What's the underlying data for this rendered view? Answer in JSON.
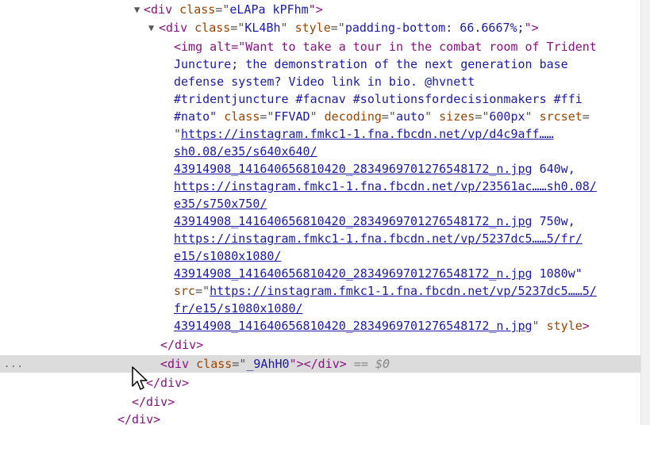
{
  "dom": {
    "line1": {
      "open": "<div",
      "attr": "class",
      "q": "=\"",
      "val": "eLAPa kPFhm",
      "close": "\">"
    },
    "line2": {
      "open": "<div",
      "class_attr": "class",
      "class_val": "KL4Bh",
      "style_attr": "style",
      "style_val": "padding-bottom: 66.6667%;",
      "close": "\">"
    },
    "img": {
      "line1": "<img alt=\"Want to take a tour in the combat room of Trident",
      "line2": "Juncture; the demonstration of the next generation base",
      "line3": "defense system? Video link in bio. @hvnett",
      "line4": "#tridentjuncture #facnav #solutionsfordecisionmakers #ffi",
      "line5_val": "#nato\"",
      "line5_class_attr": "class",
      "line5_class_val": "FFVAD",
      "line5_dec_attr": "decoding",
      "line5_dec_val": "auto",
      "line5_sizes_attr": "sizes",
      "line5_sizes_val": "600px",
      "line5_srcset_attr": "srcset",
      "srcset_link1a": "https://instagram.fmkc1-1.fna.fbcdn.net/vp/d4c9aff……",
      "srcset_link1b": "sh0.08/e35/s640x640/",
      "srcset_link1c": "43914908_141640656810420_2834969701276548172_n.jpg",
      "srcset_w1": "640w,",
      "srcset_link2a": "https://instagram.fmkc1-1.fna.fbcdn.net/vp/23561ac……sh0.08/",
      "srcset_link2b": "e35/s750x750/",
      "srcset_link2c": "43914908_141640656810420_2834969701276548172_n.jpg",
      "srcset_w2": "750w,",
      "srcset_link3a": "https://instagram.fmkc1-1.fna.fbcdn.net/vp/5237dc5……5/fr/",
      "srcset_link3b": "e15/s1080x1080/",
      "srcset_link3c": "43914908_141640656810420_2834969701276548172_n.jpg",
      "srcset_w3": "1080w\"",
      "src_attr": "src",
      "src_link1": "https://instagram.fmkc1-1.fna.fbcdn.net/vp/5237dc5……5/",
      "src_link2": "fr/e15/s1080x1080/",
      "src_link3": "43914908_141640656810420_2834969701276548172_n.jpg",
      "style_attr": "style",
      "end": ">"
    },
    "close_div1": "</div>",
    "selected": {
      "open": "<div",
      "attr": "class",
      "val": "_9AhH0",
      "close": "\"></div>",
      "eq": "==",
      "dollar": "$0"
    },
    "close_div2": "</div>",
    "close_div3": "</div>",
    "close_div4": "</div>",
    "dots": "..."
  }
}
